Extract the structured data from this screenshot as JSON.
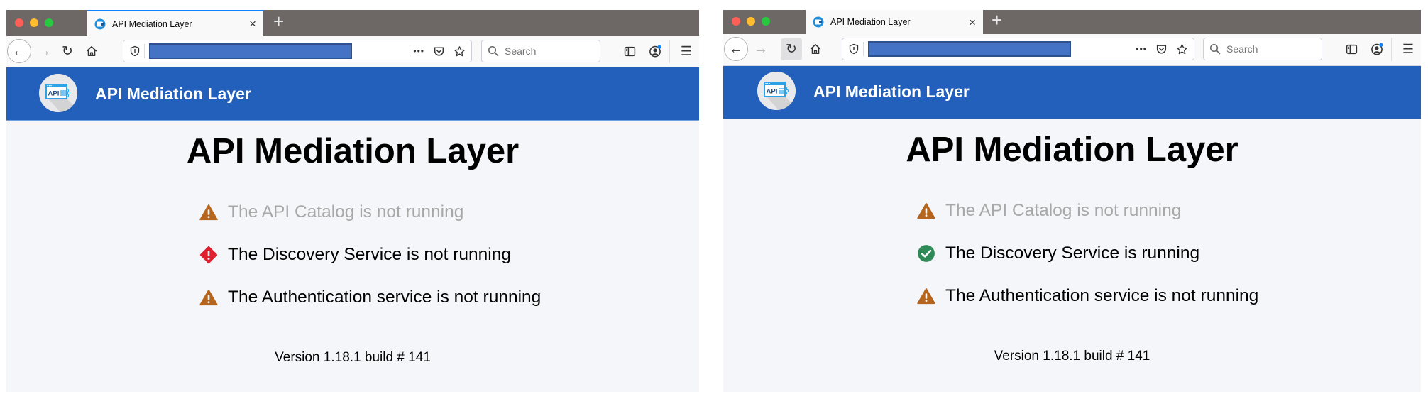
{
  "colors": {
    "header_bg": "#2360bb",
    "warning": "#b5651d",
    "error": "#e0202e",
    "success": "#2e8b57",
    "muted_text": "#a8a8a8",
    "tabbar_bg": "#6d6765",
    "url_redaction": "#4472c4"
  },
  "browsers": [
    {
      "tab": {
        "title": "API Mediation Layer",
        "favicon": "api-ml-favicon",
        "close_icon": "×"
      },
      "new_tab_label": "+",
      "toolbar": {
        "back_icon": "←",
        "forward_icon": "→",
        "reload_icon": "↻",
        "home_icon": "home",
        "page_actions_icon": "•••",
        "search_placeholder": "Search",
        "menu_icon": "☰"
      },
      "header": {
        "app_name": "API Mediation Layer",
        "logo_text": "API"
      },
      "main": {
        "title": "API Mediation Layer",
        "statuses": [
          {
            "icon": "warning-icon",
            "text": "The API Catalog is not running",
            "state": "muted"
          },
          {
            "icon": "error-icon",
            "text": "The Discovery Service is not running",
            "state": "normal"
          },
          {
            "icon": "warning-icon",
            "text": "The Authentication service is not running",
            "state": "normal"
          }
        ],
        "version": "Version 1.18.1 build # 141"
      }
    },
    {
      "tab": {
        "title": "API Mediation Layer",
        "favicon": "api-ml-favicon",
        "close_icon": "×"
      },
      "new_tab_label": "+",
      "toolbar": {
        "back_icon": "←",
        "forward_icon": "→",
        "reload_icon": "↻",
        "home_icon": "home",
        "page_actions_icon": "•••",
        "search_placeholder": "Search",
        "menu_icon": "☰"
      },
      "header": {
        "app_name": "API Mediation Layer",
        "logo_text": "API"
      },
      "main": {
        "title": "API Mediation Layer",
        "statuses": [
          {
            "icon": "warning-icon",
            "text": "The API Catalog is not running",
            "state": "muted"
          },
          {
            "icon": "success-icon",
            "text": "The Discovery Service is running",
            "state": "normal"
          },
          {
            "icon": "warning-icon",
            "text": "The Authentication service is not running",
            "state": "normal"
          }
        ],
        "version": "Version 1.18.1 build # 141"
      }
    }
  ]
}
